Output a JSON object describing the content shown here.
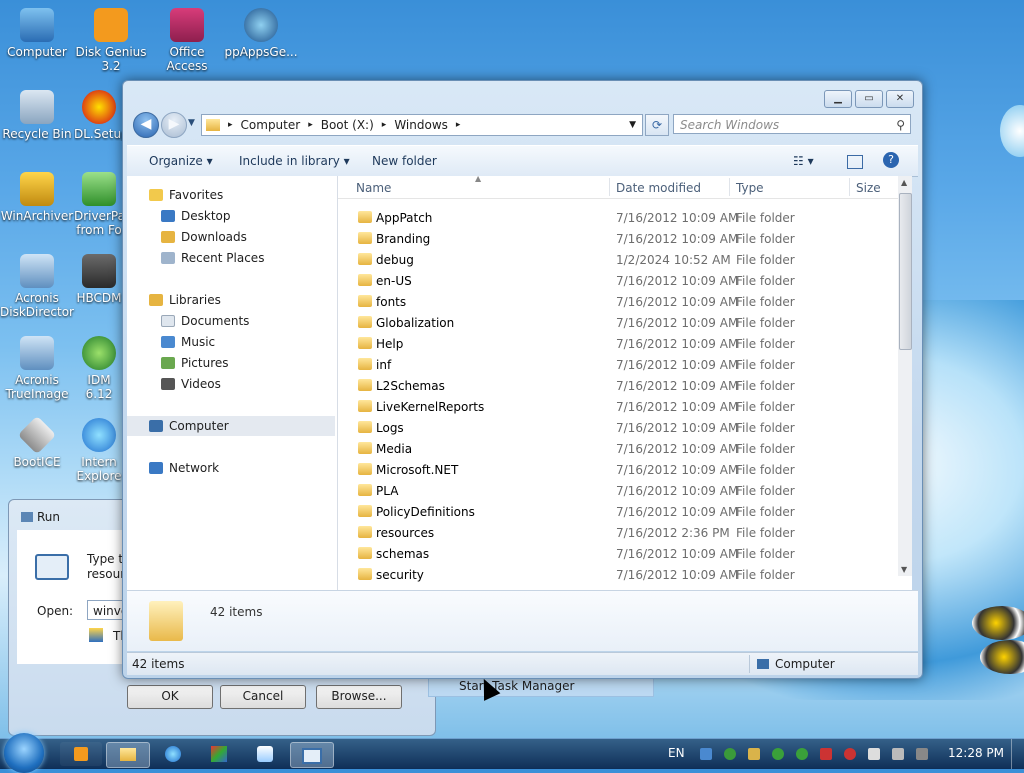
{
  "desktop_icons": [
    {
      "label": "Computer"
    },
    {
      "label": "Disk Genius 3.2"
    },
    {
      "label": "Office Access"
    },
    {
      "label": "ppAppsGe..."
    },
    {
      "label": "Recycle Bin"
    },
    {
      "label": "DL.Setup"
    },
    {
      "label": "WinArchiver"
    },
    {
      "label": "DriverPa from Fo"
    },
    {
      "label": "Acronis DiskDirector"
    },
    {
      "label": "HBCDM"
    },
    {
      "label": "Acronis TrueImage"
    },
    {
      "label": "IDM 6.12"
    },
    {
      "label": "BootICE"
    },
    {
      "label": "Intern Explore"
    }
  ],
  "explorer": {
    "breadcrumb": [
      "Computer",
      "Boot (X:)",
      "Windows"
    ],
    "search_placeholder": "Search Windows",
    "toolbar": {
      "organize": "Organize",
      "include": "Include in library",
      "new_folder": "New folder"
    },
    "nav": {
      "favorites": "Favorites",
      "desktop": "Desktop",
      "downloads": "Downloads",
      "recent": "Recent Places",
      "libraries": "Libraries",
      "documents": "Documents",
      "music": "Music",
      "pictures": "Pictures",
      "videos": "Videos",
      "computer": "Computer",
      "network": "Network"
    },
    "columns": {
      "name": "Name",
      "date": "Date modified",
      "type": "Type",
      "size": "Size"
    },
    "rows": [
      {
        "name": "AppPatch",
        "date": "7/16/2012 10:09 AM",
        "type": "File folder"
      },
      {
        "name": "Branding",
        "date": "7/16/2012 10:09 AM",
        "type": "File folder"
      },
      {
        "name": "debug",
        "date": "1/2/2024 10:52 AM",
        "type": "File folder"
      },
      {
        "name": "en-US",
        "date": "7/16/2012 10:09 AM",
        "type": "File folder"
      },
      {
        "name": "fonts",
        "date": "7/16/2012 10:09 AM",
        "type": "File folder"
      },
      {
        "name": "Globalization",
        "date": "7/16/2012 10:09 AM",
        "type": "File folder"
      },
      {
        "name": "Help",
        "date": "7/16/2012 10:09 AM",
        "type": "File folder"
      },
      {
        "name": "inf",
        "date": "7/16/2012 10:09 AM",
        "type": "File folder"
      },
      {
        "name": "L2Schemas",
        "date": "7/16/2012 10:09 AM",
        "type": "File folder"
      },
      {
        "name": "LiveKernelReports",
        "date": "7/16/2012 10:09 AM",
        "type": "File folder"
      },
      {
        "name": "Logs",
        "date": "7/16/2012 10:09 AM",
        "type": "File folder"
      },
      {
        "name": "Media",
        "date": "7/16/2012 10:09 AM",
        "type": "File folder"
      },
      {
        "name": "Microsoft.NET",
        "date": "7/16/2012 10:09 AM",
        "type": "File folder"
      },
      {
        "name": "PLA",
        "date": "7/16/2012 10:09 AM",
        "type": "File folder"
      },
      {
        "name": "PolicyDefinitions",
        "date": "7/16/2012 10:09 AM",
        "type": "File folder"
      },
      {
        "name": "resources",
        "date": "7/16/2012 2:36 PM",
        "type": "File folder"
      },
      {
        "name": "schemas",
        "date": "7/16/2012 10:09 AM",
        "type": "File folder"
      },
      {
        "name": "security",
        "date": "7/16/2012 10:09 AM",
        "type": "File folder"
      }
    ],
    "details_count": "42 items",
    "status_count": "42 items",
    "status_location": "Computer"
  },
  "run": {
    "title": "Run",
    "desc": "Type the\nresource",
    "open_label": "Open:",
    "open_value": "winver",
    "note": "Thi",
    "ok": "OK",
    "cancel": "Cancel",
    "browse": "Browse..."
  },
  "context_menu_item": "Start Task Manager",
  "taskbar": {
    "lang": "EN",
    "time": "12:28 PM"
  }
}
